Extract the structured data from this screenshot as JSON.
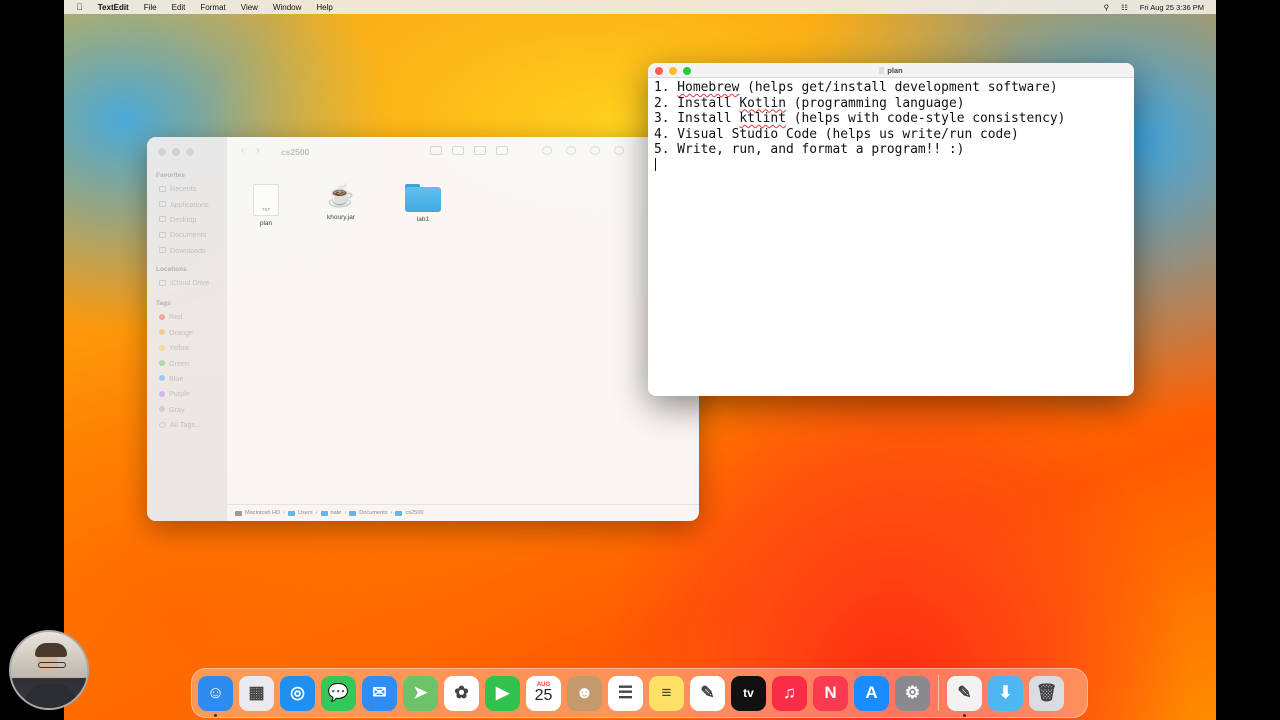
{
  "menubar": {
    "apple": "",
    "app": "TextEdit",
    "items": [
      "File",
      "Edit",
      "Format",
      "View",
      "Window",
      "Help"
    ],
    "clock": "Fri Aug 25  3:36 PM"
  },
  "finder": {
    "title": "cs2500",
    "sidebar": {
      "favorites_header": "Favorites",
      "favorites": [
        "Recents",
        "Applications",
        "Desktop",
        "Documents",
        "Downloads"
      ],
      "locations_header": "Locations",
      "locations": [
        "iCloud Drive"
      ],
      "tags_header": "Tags",
      "tags": [
        {
          "label": "Red",
          "color": "#ff6b6b"
        },
        {
          "label": "Orange",
          "color": "#ffae5c"
        },
        {
          "label": "Yellow",
          "color": "#ffd95c"
        },
        {
          "label": "Green",
          "color": "#6fd47a"
        },
        {
          "label": "Blue",
          "color": "#6aa9ff"
        },
        {
          "label": "Purple",
          "color": "#c08aff"
        },
        {
          "label": "Gray",
          "color": "#bcbcbc"
        }
      ],
      "all_tags": "All Tags..."
    },
    "files": [
      {
        "name": "plan",
        "type": "txt",
        "badge": "TXT"
      },
      {
        "name": "khoury.jar",
        "type": "jar"
      },
      {
        "name": "lab1",
        "type": "folder"
      }
    ],
    "path": [
      "Macintosh HD",
      "Users",
      "nate",
      "Documents",
      "cs2500"
    ]
  },
  "textedit": {
    "title": "plan",
    "lines": [
      {
        "num": "1. ",
        "parts": [
          {
            "t": "Homebrew",
            "sq": true
          },
          {
            "t": " (helps get/install development software)"
          }
        ]
      },
      {
        "num": "2. ",
        "parts": [
          {
            "t": "Install "
          },
          {
            "t": "Kotlin",
            "sq": true
          },
          {
            "t": " (programming language)"
          }
        ]
      },
      {
        "num": "3. ",
        "parts": [
          {
            "t": "Install "
          },
          {
            "t": "ktlint",
            "sq": true
          },
          {
            "t": " (helps with code-style consistency)"
          }
        ]
      },
      {
        "num": "4. ",
        "parts": [
          {
            "t": "Visual Studio Code (helps us write/run code)"
          }
        ]
      },
      {
        "num": "5. ",
        "parts": [
          {
            "t": "Write, run, and format a program!! :)"
          }
        ]
      }
    ]
  },
  "dock": {
    "apps": [
      {
        "name": "finder",
        "color": "#2e8cf0",
        "glyph": "☺",
        "running": true
      },
      {
        "name": "launchpad",
        "color": "#e9e9ee",
        "glyph": "▦"
      },
      {
        "name": "safari",
        "color": "#1f8ff0",
        "glyph": "◎"
      },
      {
        "name": "messages",
        "color": "#34c759",
        "glyph": "💬"
      },
      {
        "name": "mail",
        "color": "#2f8cf3",
        "glyph": "✉"
      },
      {
        "name": "maps",
        "color": "#6cc36a",
        "glyph": "➤"
      },
      {
        "name": "photos",
        "color": "#ffffff",
        "glyph": "✿"
      },
      {
        "name": "facetime",
        "color": "#31c14d",
        "glyph": "▶"
      },
      {
        "name": "calendar",
        "color": "#ffffff",
        "glyph": "25",
        "month": "AUG"
      },
      {
        "name": "contacts",
        "color": "#c49a6c",
        "glyph": "☻"
      },
      {
        "name": "reminders",
        "color": "#ffffff",
        "glyph": "☰"
      },
      {
        "name": "notes",
        "color": "#ffe066",
        "glyph": "≡"
      },
      {
        "name": "freeform",
        "color": "#ffffff",
        "glyph": "✎"
      },
      {
        "name": "tv",
        "color": "#111111",
        "glyph": "tv"
      },
      {
        "name": "music",
        "color": "#fa2d48",
        "glyph": "♫"
      },
      {
        "name": "news",
        "color": "#fa3a50",
        "glyph": "N"
      },
      {
        "name": "app-store",
        "color": "#1a8cff",
        "glyph": "A"
      },
      {
        "name": "system-settings",
        "color": "#8a8a8e",
        "glyph": "⚙"
      }
    ],
    "extras": [
      {
        "name": "textedit",
        "color": "#f2f2f2",
        "glyph": "✎",
        "running": true
      },
      {
        "name": "downloads",
        "color": "#4fb6f2",
        "glyph": "⬇"
      },
      {
        "name": "trash",
        "color": "#d9dde2",
        "glyph": "🗑"
      }
    ]
  }
}
